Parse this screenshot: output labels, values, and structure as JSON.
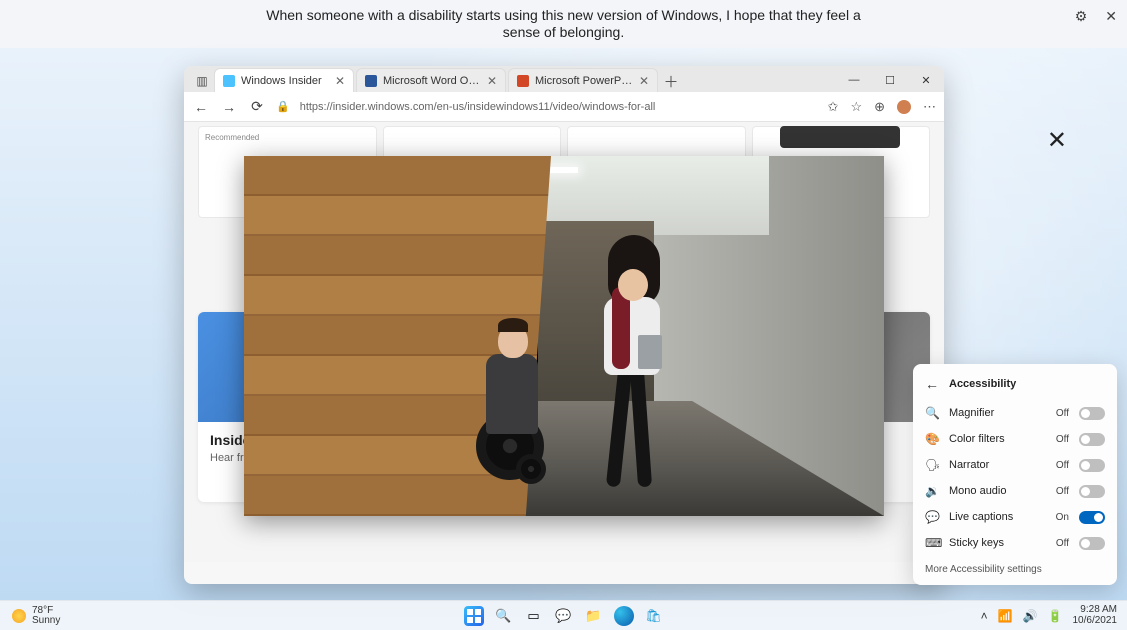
{
  "caption": {
    "text": "When someone with a disability starts using this new version of Windows, I hope that they feel a sense of belonging."
  },
  "browser": {
    "tabs": [
      {
        "label": "Windows Insider",
        "color": "#4cc2ff"
      },
      {
        "label": "Microsoft Word Online",
        "color": "#2b579a"
      },
      {
        "label": "Microsoft PowerPoint Online",
        "color": "#d24726"
      }
    ],
    "url": "https://insider.windows.com/en-us/insidewindows11/video/windows-for-all",
    "card": {
      "title": "Inside",
      "sub": "Hear from about W"
    }
  },
  "a11y": {
    "title": "Accessibility",
    "items": [
      {
        "icon": "🔍",
        "label": "Magnifier",
        "state": "Off",
        "on": false,
        "name": "magnifier"
      },
      {
        "icon": "🎨",
        "label": "Color filters",
        "state": "Off",
        "on": false,
        "name": "color-filters"
      },
      {
        "icon": "🗣",
        "label": "Narrator",
        "state": "Off",
        "on": false,
        "name": "narrator"
      },
      {
        "icon": "🔉",
        "label": "Mono audio",
        "state": "Off",
        "on": false,
        "name": "mono-audio"
      },
      {
        "icon": "💬",
        "label": "Live captions",
        "state": "On",
        "on": true,
        "name": "live-captions"
      },
      {
        "icon": "⌨",
        "label": "Sticky keys",
        "state": "Off",
        "on": false,
        "name": "sticky-keys"
      }
    ],
    "footer": "More Accessibility settings"
  },
  "taskbar": {
    "weather": {
      "temp": "78°F",
      "cond": "Sunny"
    },
    "clock": {
      "time": "9:28 AM",
      "date": "10/6/2021"
    }
  }
}
